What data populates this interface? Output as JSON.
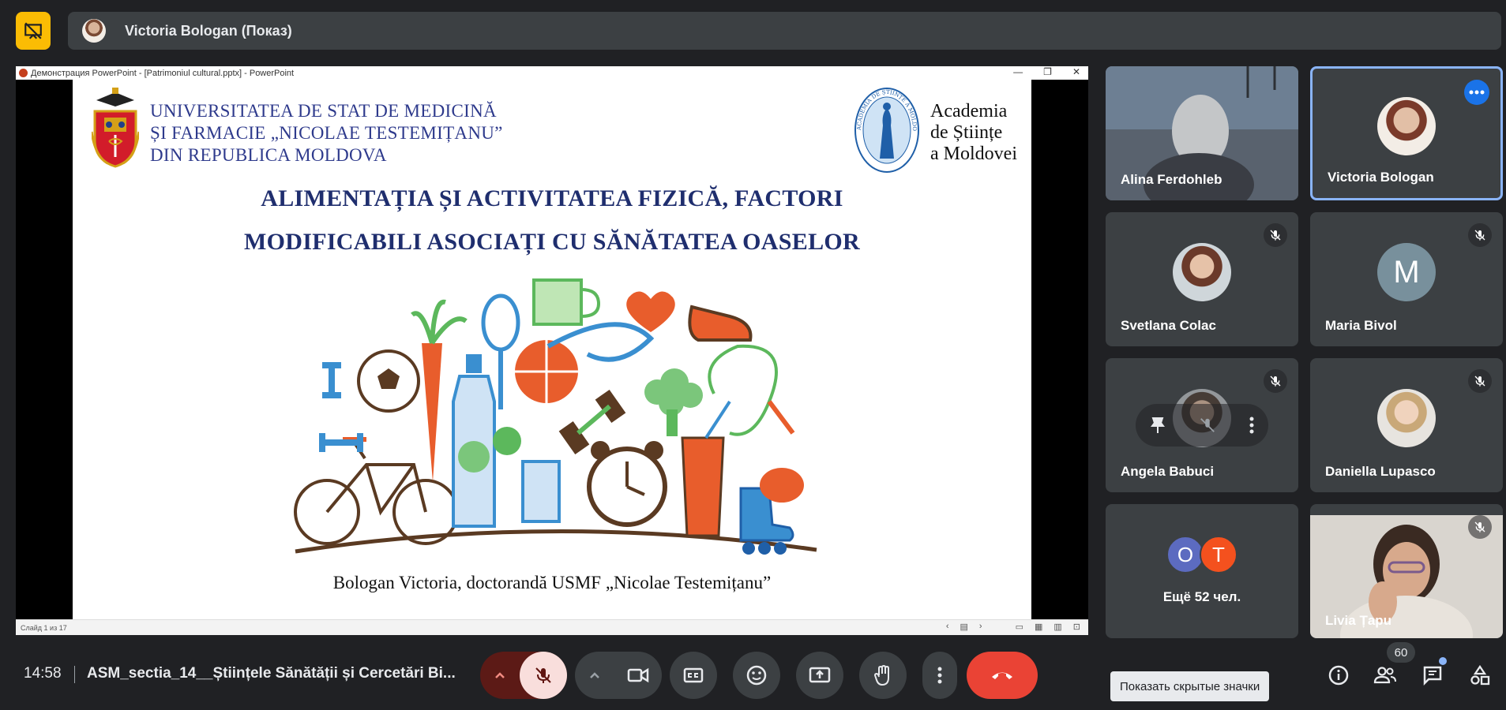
{
  "presenter_bar": {
    "name": "Victoria Bologan (Показ)"
  },
  "powerpoint": {
    "window_title": "Демонстрация PowerPoint - [Patrimoniul cultural.pptx] - PowerPoint",
    "status": "Слайд 1 из 17"
  },
  "slide": {
    "university_lines": [
      "UNIVERSITATEA DE STAT DE MEDICINĂ",
      "ȘI FARMACIE „NICOLAE TESTEMIȚANU”",
      "DIN REPUBLICA MOLDOVA"
    ],
    "academy_lines": [
      "Academia",
      "de Științe",
      "a Moldovei"
    ],
    "title_line1": "ALIMENTAȚIA ȘI ACTIVITATEA FIZICĂ, FACTORI",
    "title_line2": "MODIFICABILI ASOCIAȚI CU SĂNĂTATEA OASELOR",
    "author": "Bologan Victoria, doctorandă USMF „Nicolae Testemițanu”",
    "seal_text": "ACADEMIA DE ȘTIINȚE A MOLDOVEI"
  },
  "participants": [
    {
      "name": "Alina Ferdohleb"
    },
    {
      "name": "Victoria Bologan"
    },
    {
      "name": "Svetlana Colac"
    },
    {
      "name": "Maria Bivol",
      "initial": "M"
    },
    {
      "name": "Angela Babuci"
    },
    {
      "name": "Daniella Lupasco"
    },
    {
      "name": "Livia Țapu"
    }
  ],
  "others": {
    "initials": [
      "O",
      "T"
    ],
    "label": "Ещё 52 чел."
  },
  "toolbar": {
    "time": "14:58",
    "meeting_name": "ASM_sectia_14__Științele Sănătății și Cercetări Bi...",
    "tooltip": "Показать скрытые значки",
    "participant_count": "60"
  },
  "colors": {
    "accent_blue": "#8ab4f8",
    "present_yellow": "#fbbc04",
    "end_call_red": "#ea4335",
    "mic_off_bg": "#f9dedc",
    "title_blue": "#1f2e6e"
  }
}
